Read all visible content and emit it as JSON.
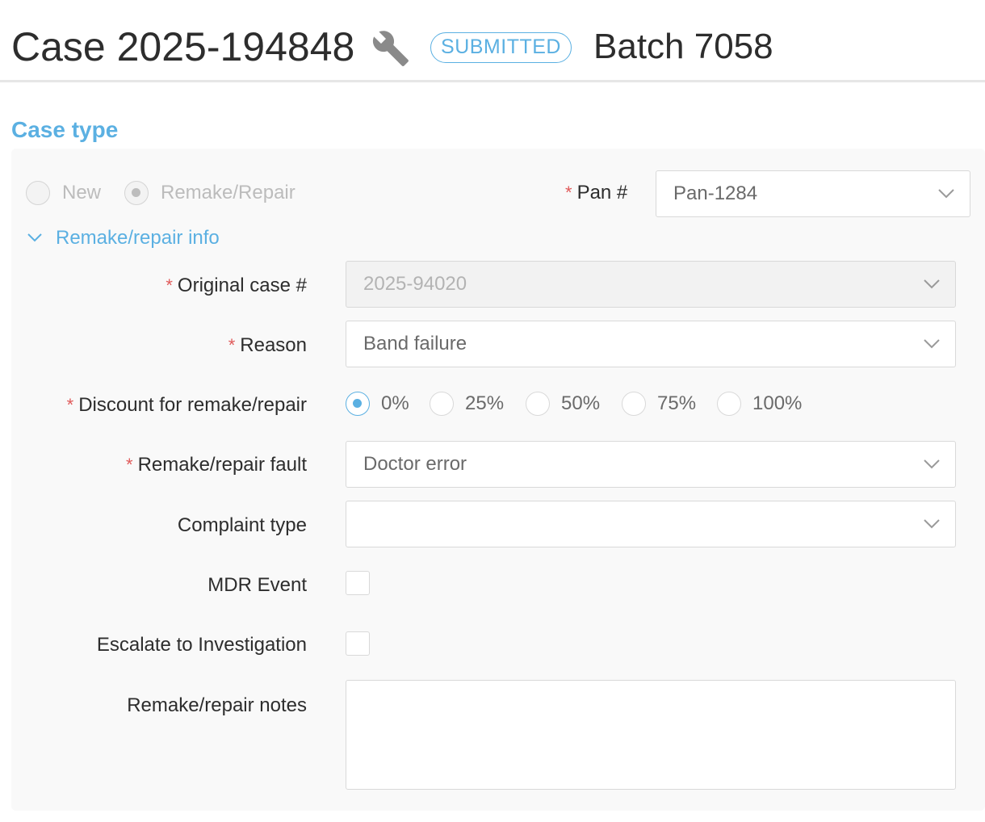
{
  "header": {
    "case_title": "Case 2025-194848",
    "status_badge": "SUBMITTED",
    "batch_title": "Batch 7058",
    "icon": "wrench-icon"
  },
  "case_type": {
    "section_title": "Case type",
    "options": [
      {
        "label": "New",
        "selected": false
      },
      {
        "label": "Remake/Repair",
        "selected": true
      }
    ],
    "pan": {
      "label": "Pan #",
      "value": "Pan-1284"
    }
  },
  "remake_info": {
    "toggle_label": "Remake/repair info",
    "original_case": {
      "label": "Original case #",
      "value": "2025-94020"
    },
    "reason": {
      "label": "Reason",
      "value": "Band failure"
    },
    "discount": {
      "label": "Discount for remake/repair",
      "options": [
        "0%",
        "25%",
        "50%",
        "75%",
        "100%"
      ],
      "selected": "0%"
    },
    "fault": {
      "label": "Remake/repair fault",
      "value": "Doctor error"
    },
    "complaint_type": {
      "label": "Complaint type",
      "value": ""
    },
    "mdr_event": {
      "label": "MDR Event",
      "checked": false
    },
    "escalate": {
      "label": "Escalate to Investigation",
      "checked": false
    },
    "notes": {
      "label": "Remake/repair notes",
      "value": ""
    }
  },
  "colors": {
    "accent": "#5bb0e2",
    "required": "#e05a5a",
    "panel_bg": "#f9f9f9"
  }
}
